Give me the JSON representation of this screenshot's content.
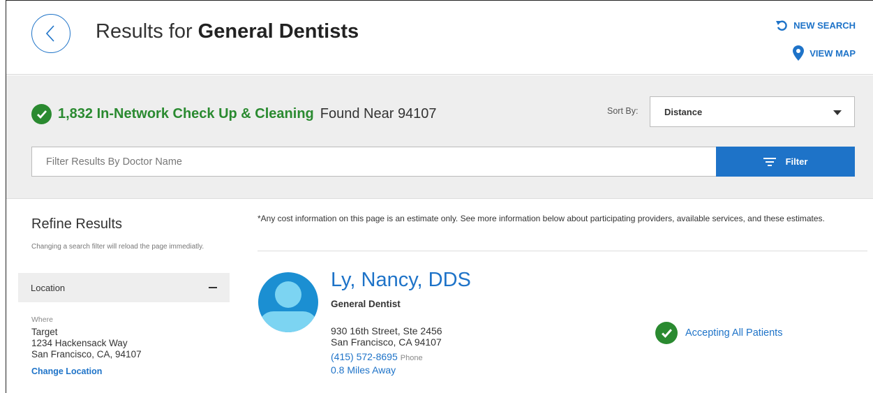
{
  "header": {
    "title_prefix": "Results for",
    "title_bold": "General Dentists",
    "new_search": "NEW SEARCH",
    "view_map": "VIEW MAP"
  },
  "summary": {
    "count_text": "1,832 In-Network Check Up & Cleaning",
    "found_text": "Found Near 94107",
    "sort_label": "Sort By:",
    "sort_value": "Distance"
  },
  "filter": {
    "placeholder": "Filter Results By Doctor Name",
    "button": "Filter"
  },
  "sidebar": {
    "title": "Refine Results",
    "note": "Changing a search filter will reload the page immediatly.",
    "location_label": "Location",
    "where_label": "Where",
    "address_lines": [
      "Target",
      "1234 Hackensack Way",
      "San Francisco, CA, 94107"
    ],
    "change_location": "Change Location"
  },
  "results": {
    "disclaimer": "*Any cost information on this page is an estimate only. See more information below about participating providers, available services, and these estimates.",
    "items": [
      {
        "name": "Ly, Nancy, DDS",
        "specialty": "General Dentist",
        "address_line1": "930 16th Street, Ste 2456",
        "address_line2": "San Francisco, CA 94107",
        "phone": "(415) 572-8695",
        "phone_label": "Phone",
        "distance": "0.8 Miles Away",
        "status": "Accepting All Patients"
      }
    ]
  },
  "colors": {
    "primary_blue": "#1e73c8",
    "success_green": "#2a8a30",
    "band_gray": "#eeeeee"
  }
}
